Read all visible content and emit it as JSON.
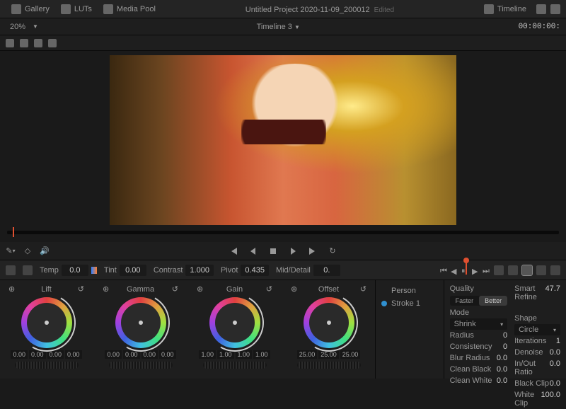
{
  "topbar": {
    "gallery": "Gallery",
    "luts": "LUTs",
    "mediapool": "Media Pool",
    "title": "Untitled Project 2020-11-09_200012",
    "edited": "Edited",
    "timeline_btn": "Timeline"
  },
  "subbar": {
    "zoom": "20%",
    "timeline_name": "Timeline 3",
    "timecode": "00:00:00:"
  },
  "params": {
    "temp": {
      "label": "Temp",
      "value": "0.0"
    },
    "tint": {
      "label": "Tint",
      "value": "0.00"
    },
    "contrast": {
      "label": "Contrast",
      "value": "1.000"
    },
    "pivot": {
      "label": "Pivot",
      "value": "0.435"
    },
    "middetail": {
      "label": "Mid/Detail",
      "value": "0."
    }
  },
  "wheels": {
    "lift": {
      "label": "Lift",
      "vals": [
        "0.00",
        "0.00",
        "0.00",
        "0.00"
      ]
    },
    "gamma": {
      "label": "Gamma",
      "vals": [
        "0.00",
        "0.00",
        "0.00",
        "0.00"
      ]
    },
    "gain": {
      "label": "Gain",
      "vals": [
        "1.00",
        "1.00",
        "1.00",
        "1.00"
      ]
    },
    "offset": {
      "label": "Offset",
      "vals": [
        "25.00",
        "25.00",
        "25.00"
      ]
    }
  },
  "midpanel": {
    "person": "Person",
    "stroke1": "Stroke 1",
    "person_color": "#e05030",
    "stroke_color": "#3090d0"
  },
  "right": {
    "quality": "Quality",
    "faster": "Faster",
    "better": "Better",
    "smart_refine": {
      "label": "Smart Refine",
      "value": "47.7"
    },
    "mode": "Mode",
    "shape": "Shape",
    "shrink": "Shrink",
    "circle": "Circle",
    "radius": {
      "label": "Radius",
      "value": "0"
    },
    "iterations": {
      "label": "Iterations",
      "value": "1"
    },
    "consistency": {
      "label": "Consistency",
      "value": "0"
    },
    "denoise": {
      "label": "Denoise",
      "value": "0.0"
    },
    "blur_radius": {
      "label": "Blur Radius",
      "value": "0.0"
    },
    "inout_ratio": {
      "label": "In/Out Ratio",
      "value": "0.0"
    },
    "clean_black": {
      "label": "Clean Black",
      "value": "0.0"
    },
    "black_clip": {
      "label": "Black Clip",
      "value": "0.0"
    },
    "clean_white": {
      "label": "Clean White",
      "value": "0.0"
    },
    "white_clip": {
      "label": "White Clip",
      "value": "100.0"
    }
  }
}
